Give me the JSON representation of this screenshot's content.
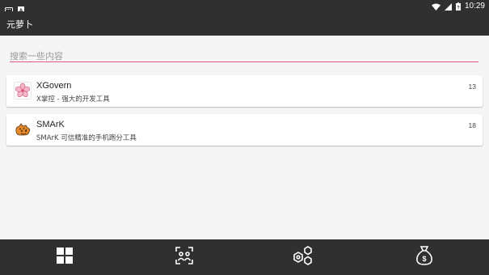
{
  "status_bar": {
    "time": "10:29",
    "icons": [
      "keyboard-icon",
      "a-notification-icon",
      "wifi-icon",
      "signal-icon",
      "battery-icon"
    ]
  },
  "app_bar": {
    "title": "元萝卜"
  },
  "search": {
    "placeholder": "搜索一些内容",
    "value": ""
  },
  "apps": [
    {
      "name": "XGovern",
      "description": "X掌控 - 强大的开发工具",
      "count": "13",
      "icon": "sakura-flower-icon"
    },
    {
      "name": "SMArK",
      "description": "SMArK 可信精准的手机跑分工具",
      "count": "18",
      "icon": "tiger-mascot-icon"
    }
  ],
  "bottom_nav": [
    {
      "icon": "grid-apps-icon"
    },
    {
      "icon": "people-scan-icon"
    },
    {
      "icon": "hexagon-nodes-icon"
    },
    {
      "icon": "money-bag-icon"
    }
  ],
  "colors": {
    "bar_background": "#303030",
    "search_underline": "#e0568e",
    "background": "#f5f5f5"
  }
}
